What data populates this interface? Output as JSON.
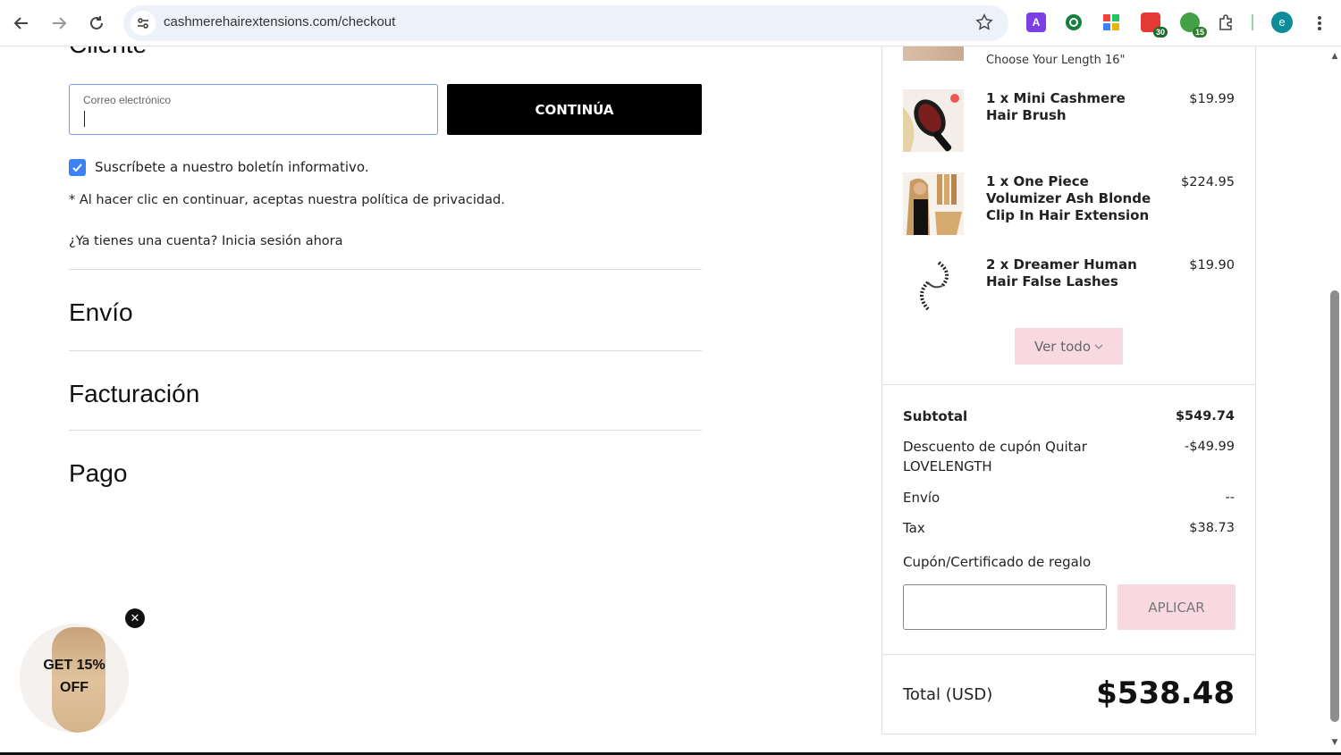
{
  "browser": {
    "url": "cashmerehairextensions.com/checkout",
    "avatar_letter": "e",
    "badge1": "30",
    "badge2": "15"
  },
  "customer": {
    "title": "Cliente",
    "email_label": "Correo electrónico",
    "email_value": "",
    "continue_label": "CONTINÚA",
    "newsletter_label": "Suscríbete a nuestro boletín informativo.",
    "newsletter_checked": true,
    "privacy_text": "* Al hacer clic en continuar, aceptas nuestra política de privacidad.",
    "login_text": "¿Ya tienes una cuenta? Inicia sesión ahora"
  },
  "sections": {
    "shipping": "Envío",
    "billing": "Facturación",
    "payment": "Pago"
  },
  "promo": {
    "line1": "GET 15%",
    "line2": "OFF"
  },
  "cart": {
    "variant_text": "Choose Your Length 16\"",
    "items": [
      {
        "name": "1 x Mini Cashmere Hair Brush",
        "price": "$19.99"
      },
      {
        "name": "1 x One Piece Volumizer Ash Blonde Clip In Hair Extension",
        "price": "$224.95"
      },
      {
        "name": "2 x Dreamer Human Hair False Lashes",
        "price": "$19.90"
      }
    ],
    "view_all": "Ver todo"
  },
  "summary": {
    "subtotal_label": "Subtotal",
    "subtotal_value": "$549.74",
    "discount_label": "Descuento de cupón Quitar",
    "discount_code": "LOVELENGTH",
    "discount_value": "-$49.99",
    "shipping_label": "Envío",
    "shipping_value": "--",
    "tax_label": "Tax",
    "tax_value": "$38.73",
    "coupon_label": "Cupón/Certificado de regalo",
    "apply_label": "APLICAR",
    "total_label": "Total (USD)",
    "total_value": "$538.48"
  },
  "colors": {
    "accent_blue": "#3b82f6",
    "pink": "#f8d9e1",
    "black": "#000000"
  }
}
